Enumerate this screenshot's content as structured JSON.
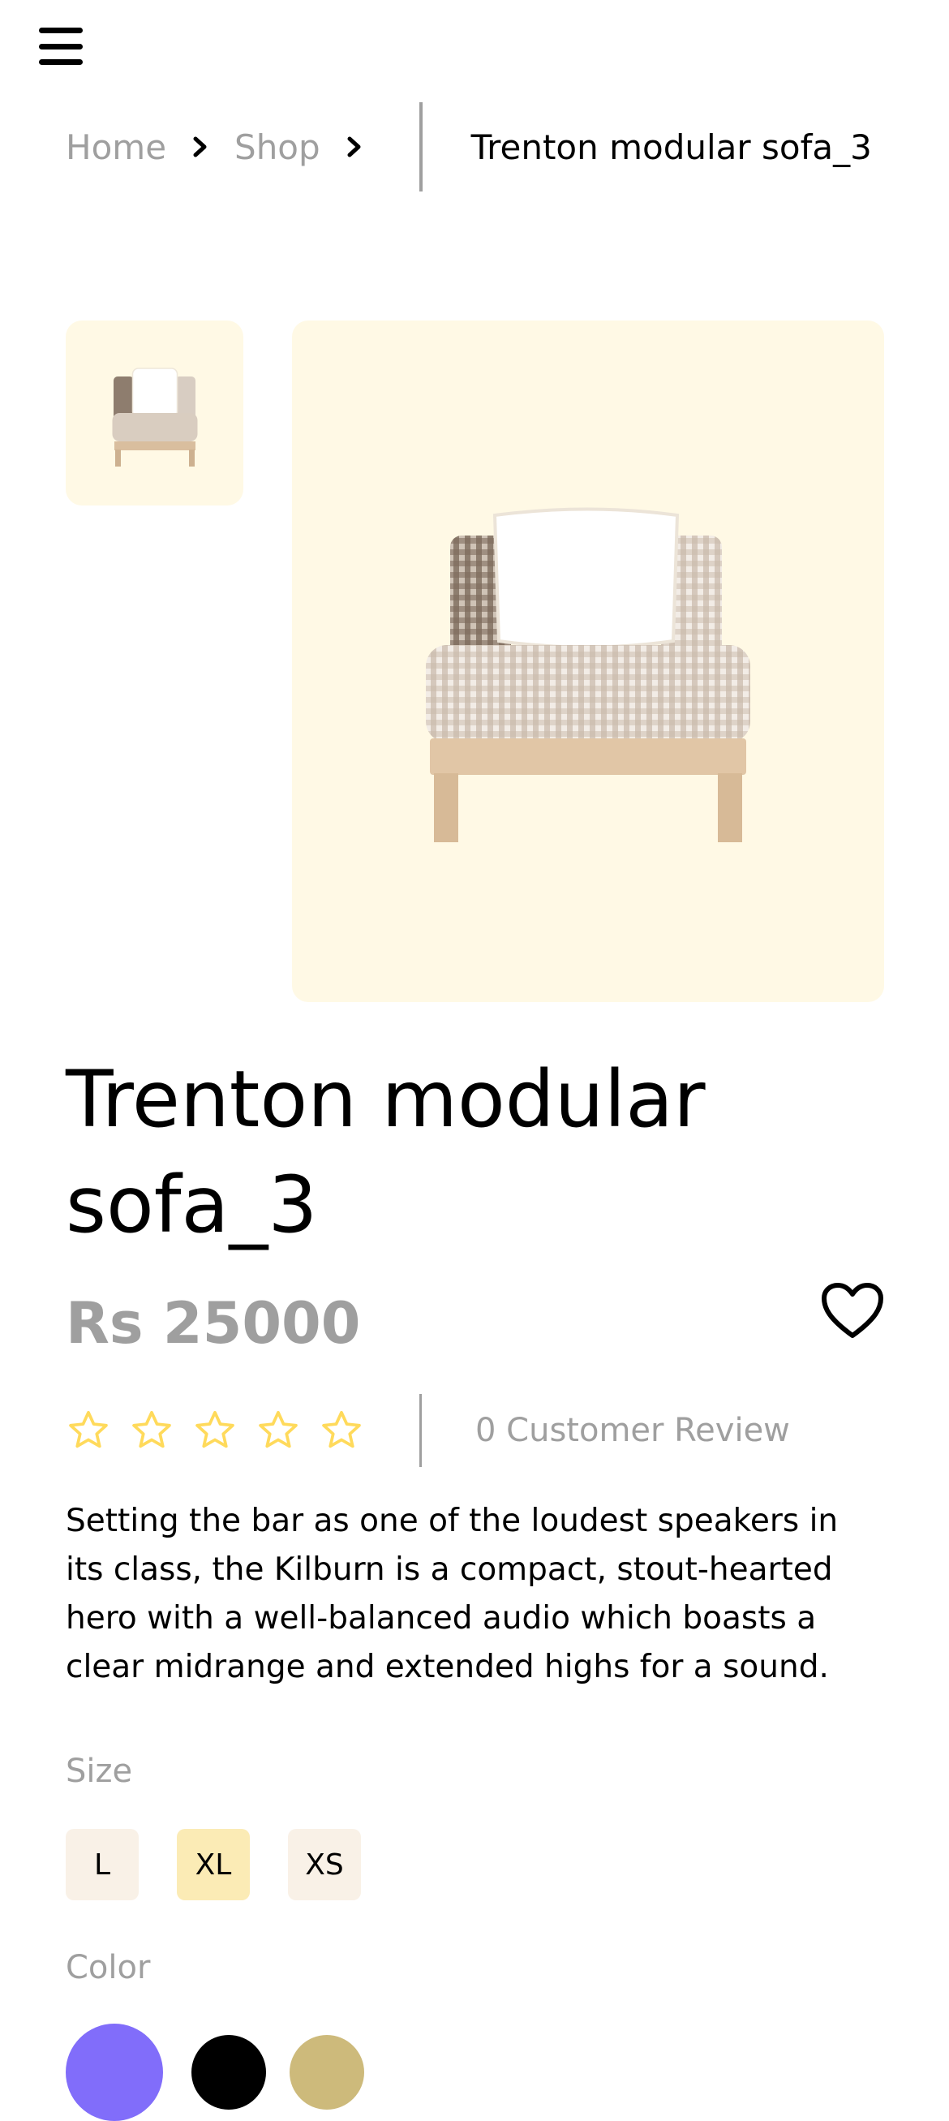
{
  "nav": {
    "menu_icon": "hamburger-menu-icon"
  },
  "breadcrumb": {
    "home": "Home",
    "shop": "Shop",
    "separator_icon": "chevron-right-icon",
    "current": "Trenton modular sofa_3"
  },
  "gallery": {
    "thumbnail_icon": "sofa-image",
    "main_image": "sofa-image"
  },
  "product": {
    "title": "Trenton modular sofa_3",
    "price": "Rs 25000",
    "wishlist_icon": "heart-icon",
    "rating": 0,
    "rating_max": 5,
    "review_count_text": "0 Customer Review",
    "description": "Setting the bar as one of the loudest speakers in its class, the Kilburn is a compact, stout-hearted hero with a well-balanced audio which boasts a clear midrange and extended highs for a sound."
  },
  "size": {
    "label": "Size",
    "options": [
      "L",
      "XL",
      "XS"
    ],
    "selected": "XL"
  },
  "color": {
    "label": "Color",
    "options": [
      "#816DFA",
      "#000000",
      "#CDBA7B"
    ]
  },
  "colors": {
    "accent_bg": "#FFF9E5",
    "muted_text": "#9F9F9F",
    "star": "#FFDA5B",
    "size_bg": "#F9F1E7",
    "size_active_bg": "#FBEBB5"
  }
}
